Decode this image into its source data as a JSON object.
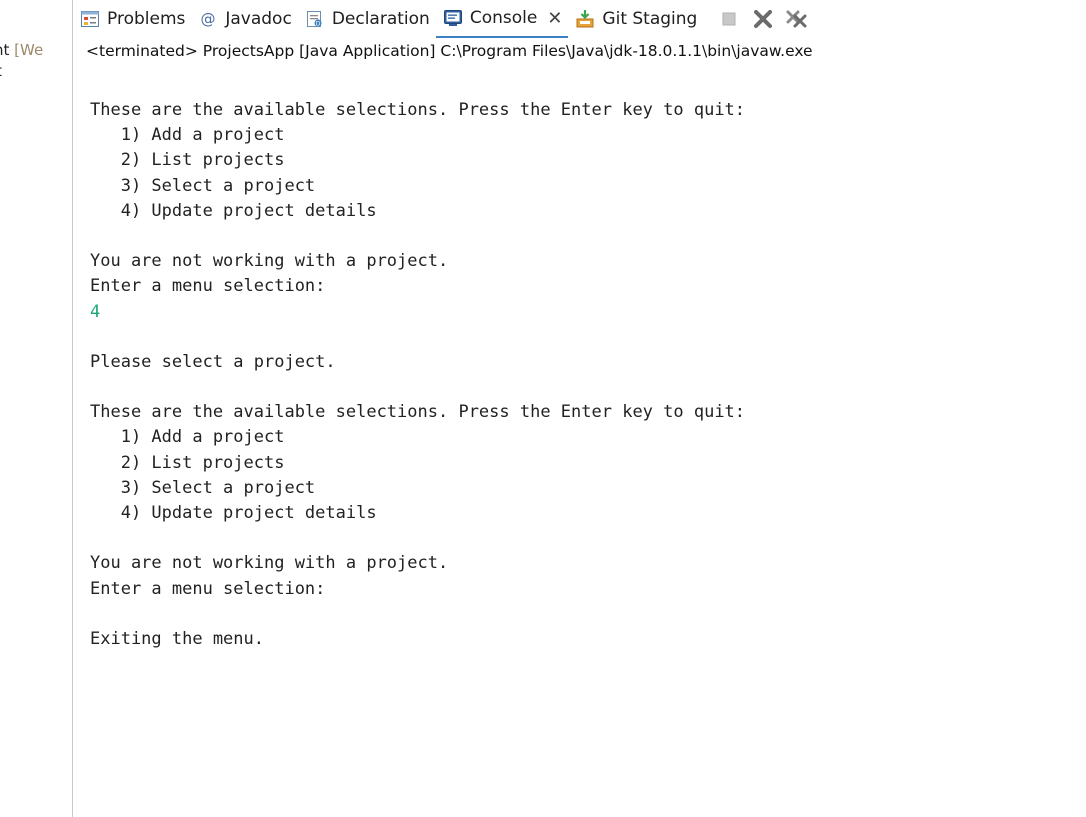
{
  "left_panel": {
    "line1_text": "nt ",
    "line1_suffix": "[We",
    "line2_text": "t"
  },
  "tabs": [
    {
      "label": "Problems",
      "icon": "problems-icon"
    },
    {
      "label": "Javadoc",
      "icon": "javadoc-icon"
    },
    {
      "label": "Declaration",
      "icon": "declaration-icon"
    },
    {
      "label": "Console",
      "icon": "console-icon",
      "active": true
    },
    {
      "label": "Git Staging",
      "icon": "git-staging-icon"
    }
  ],
  "toolbar": {
    "stop_icon": "stop-icon",
    "remove_launch_icon": "remove-launch-icon",
    "remove_all_icon": "remove-all-terminated-icon"
  },
  "console": {
    "header": "<terminated> ProjectsApp [Java Application] C:\\Program Files\\Java\\jdk-18.0.1.1\\bin\\javaw.exe",
    "lines": [
      {
        "text": "These are the available selections. Press the Enter key to quit:",
        "kind": "output"
      },
      {
        "text": "   1) Add a project",
        "kind": "output"
      },
      {
        "text": "   2) List projects",
        "kind": "output"
      },
      {
        "text": "   3) Select a project",
        "kind": "output"
      },
      {
        "text": "   4) Update project details",
        "kind": "output"
      },
      {
        "text": "",
        "kind": "output"
      },
      {
        "text": "You are not working with a project.",
        "kind": "output"
      },
      {
        "text": "Enter a menu selection:",
        "kind": "output"
      },
      {
        "text": "4",
        "kind": "input"
      },
      {
        "text": "",
        "kind": "output"
      },
      {
        "text": "Please select a project.",
        "kind": "output"
      },
      {
        "text": "",
        "kind": "output"
      },
      {
        "text": "These are the available selections. Press the Enter key to quit:",
        "kind": "output"
      },
      {
        "text": "   1) Add a project",
        "kind": "output"
      },
      {
        "text": "   2) List projects",
        "kind": "output"
      },
      {
        "text": "   3) Select a project",
        "kind": "output"
      },
      {
        "text": "   4) Update project details",
        "kind": "output"
      },
      {
        "text": "",
        "kind": "output"
      },
      {
        "text": "You are not working with a project.",
        "kind": "output"
      },
      {
        "text": "Enter a menu selection:",
        "kind": "output"
      },
      {
        "text": "",
        "kind": "output"
      },
      {
        "text": "Exiting the menu.",
        "kind": "output"
      }
    ]
  },
  "colors": {
    "input_text": "#1fa874",
    "active_tab_underline": "#3d7fc4",
    "left_panel_dim": "#9c8a6a"
  }
}
